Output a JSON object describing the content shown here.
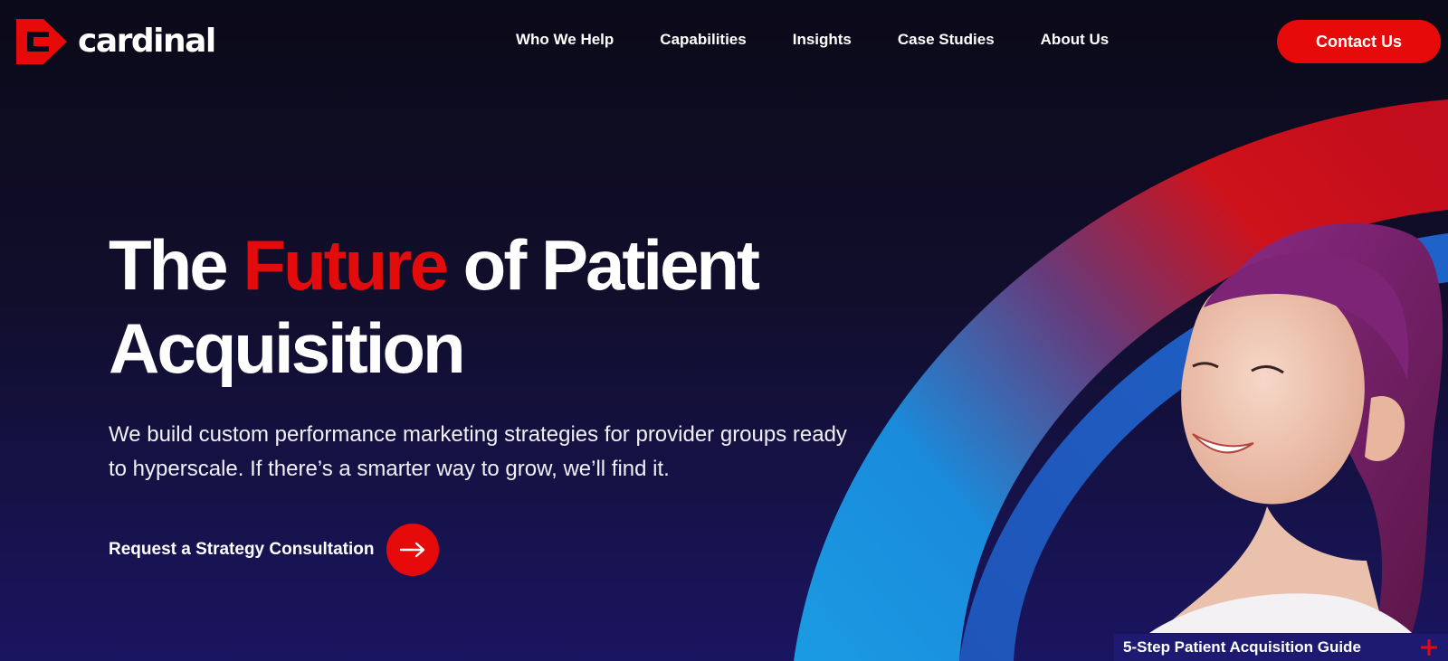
{
  "brand": {
    "name": "cardinal",
    "accent_color": "#e60a0a"
  },
  "nav": {
    "items": [
      {
        "label": "Who We Help"
      },
      {
        "label": "Capabilities"
      },
      {
        "label": "Insights"
      },
      {
        "label": "Case Studies"
      },
      {
        "label": "About Us"
      }
    ],
    "contact_label": "Contact Us"
  },
  "hero": {
    "headline_part1": "The ",
    "headline_accent": "Future",
    "headline_part2": " of Patient",
    "headline_line2": "Acquisition",
    "subtext": "We build custom performance marketing strategies for provider groups ready to hyperscale. If there’s a smarter way to grow, we’ll find it.",
    "cta_label": "Request a Strategy Consultation",
    "cta_icon": "arrow-right-icon",
    "image": "smiling-woman-photo"
  },
  "guide": {
    "label": "5-Step Patient Acquisition Guide",
    "icon": "plus-icon"
  }
}
